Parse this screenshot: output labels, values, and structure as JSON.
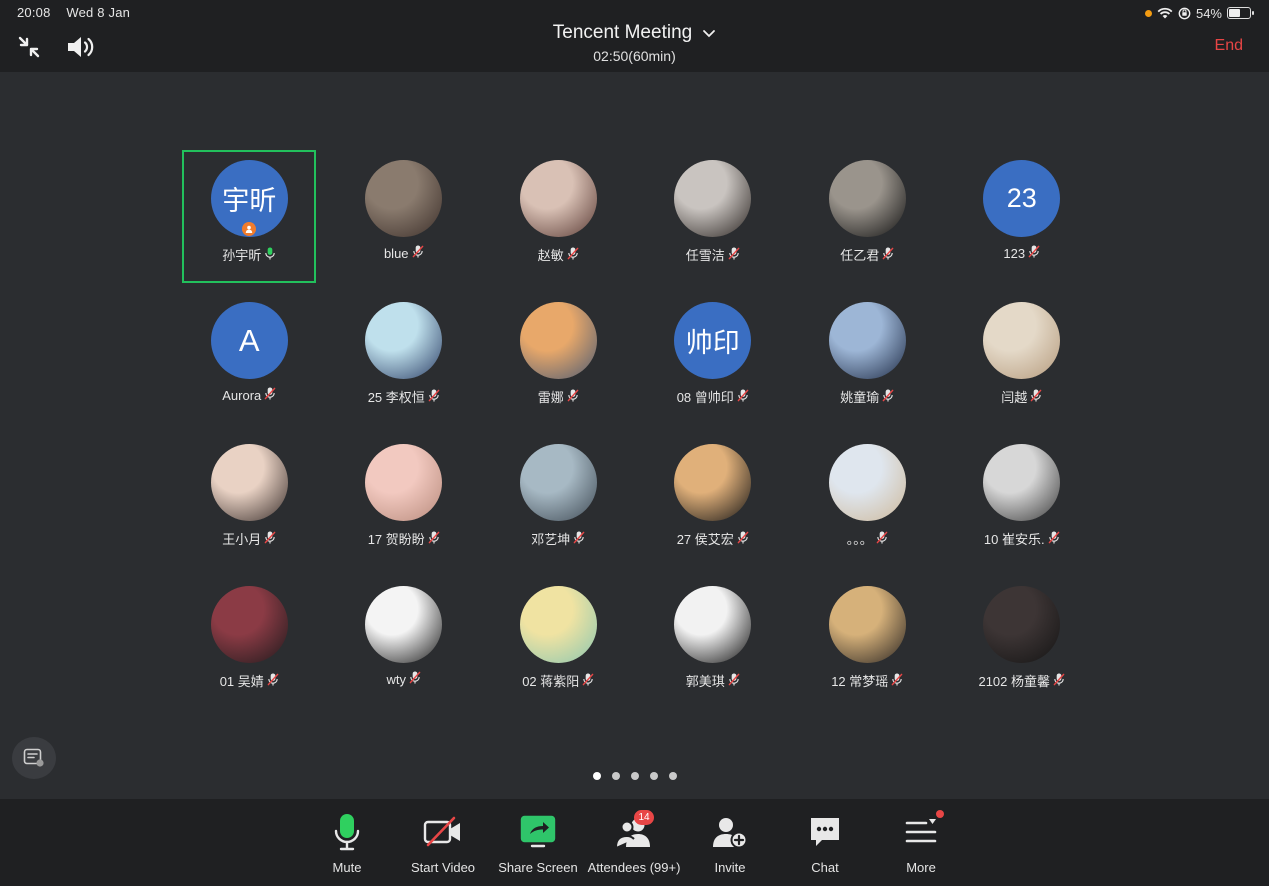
{
  "status_bar": {
    "time": "20:08",
    "date": "Wed 8 Jan",
    "battery": "54%",
    "battery_level": 0.54
  },
  "header": {
    "title": "Tencent Meeting",
    "timer": "02:50(60min)",
    "end_label": "End",
    "icons": [
      "collapse-icon",
      "speaker-icon",
      "chevron-down-icon"
    ]
  },
  "participants": [
    {
      "name": "孙宇昕",
      "avatar_text": "宇昕",
      "avatar_type": "text",
      "mic": "active",
      "host": true,
      "highlighted": true
    },
    {
      "name": "blue",
      "avatar_type": "photo",
      "mic": "muted",
      "photo_colors": [
        "#8a7b6e",
        "#3c2f2a"
      ]
    },
    {
      "name": "赵敏",
      "avatar_type": "photo",
      "mic": "muted",
      "photo_colors": [
        "#d9c1b5",
        "#5a3b35"
      ]
    },
    {
      "name": "任雪洁",
      "avatar_type": "photo",
      "mic": "muted",
      "photo_colors": [
        "#c9c4c0",
        "#2b2522"
      ]
    },
    {
      "name": "任乙君",
      "avatar_type": "photo",
      "mic": "muted",
      "photo_colors": [
        "#9a948c",
        "#111111"
      ]
    },
    {
      "name": "123",
      "avatar_text": "23",
      "avatar_type": "text",
      "mic": "muted"
    },
    {
      "name": "Aurora",
      "avatar_text": "A",
      "avatar_type": "text",
      "mic": "muted"
    },
    {
      "name": "25 李权恒",
      "avatar_type": "photo",
      "mic": "muted",
      "photo_colors": [
        "#bfe0ec",
        "#2d3f66"
      ]
    },
    {
      "name": "雷娜",
      "avatar_type": "photo",
      "mic": "muted",
      "photo_colors": [
        "#e8a86a",
        "#4d5b73"
      ]
    },
    {
      "name": "08 曾帅印",
      "avatar_text": "帅印",
      "avatar_type": "text",
      "mic": "muted"
    },
    {
      "name": "姚童瑜",
      "avatar_type": "photo",
      "mic": "muted",
      "photo_colors": [
        "#9db6d6",
        "#1e2b45"
      ]
    },
    {
      "name": "闫越",
      "avatar_type": "photo",
      "mic": "muted",
      "photo_colors": [
        "#e4d9c8",
        "#b59a7c"
      ]
    },
    {
      "name": "王小月",
      "avatar_type": "photo",
      "mic": "muted",
      "photo_colors": [
        "#e9d2c4",
        "#3a2f2c"
      ]
    },
    {
      "name": "17 贺盼盼",
      "avatar_type": "photo",
      "mic": "muted",
      "photo_colors": [
        "#f2c9c0",
        "#b78a7b"
      ]
    },
    {
      "name": "邓艺坤",
      "avatar_type": "photo",
      "mic": "muted",
      "photo_colors": [
        "#a7b9c4",
        "#3f4a54"
      ]
    },
    {
      "name": "27 侯艾宏",
      "avatar_type": "photo",
      "mic": "muted",
      "photo_colors": [
        "#e0b07a",
        "#151515"
      ]
    },
    {
      "name": "。。。",
      "avatar_type": "photo",
      "mic": "muted",
      "photo_colors": [
        "#dfe6ee",
        "#cdb89a"
      ]
    },
    {
      "name": "10 崔安乐.",
      "avatar_type": "photo",
      "mic": "muted",
      "photo_colors": [
        "#d7d7d7",
        "#3a3a3a"
      ]
    },
    {
      "name": "01 吴婧",
      "avatar_type": "photo",
      "mic": "muted",
      "photo_colors": [
        "#8b3b45",
        "#1e1a1c"
      ]
    },
    {
      "name": "wty",
      "avatar_type": "photo",
      "mic": "muted",
      "photo_colors": [
        "#f4f4f4",
        "#1a1a1a"
      ]
    },
    {
      "name": "02 蒋紫阳",
      "avatar_type": "photo",
      "mic": "muted",
      "photo_colors": [
        "#f0e3a2",
        "#8ac6b0"
      ]
    },
    {
      "name": "郭美琪",
      "avatar_type": "photo",
      "mic": "muted",
      "photo_colors": [
        "#f2f2f2",
        "#111111"
      ]
    },
    {
      "name": "12 常梦瑶",
      "avatar_type": "photo",
      "mic": "muted",
      "photo_colors": [
        "#d6b17a",
        "#2a2522"
      ]
    },
    {
      "name": "2102 杨童馨",
      "avatar_type": "photo",
      "mic": "muted",
      "photo_colors": [
        "#3d3535",
        "#141414"
      ]
    }
  ],
  "pager": {
    "pages": 5,
    "current": 0
  },
  "side_button": {
    "icon": "caption-icon"
  },
  "toolbar": [
    {
      "key": "mute",
      "label": "Mute",
      "icon": "microphone-icon"
    },
    {
      "key": "video",
      "label": "Start Video",
      "icon": "camera-off-icon"
    },
    {
      "key": "share",
      "label": "Share Screen",
      "icon": "share-screen-icon"
    },
    {
      "key": "attendees",
      "label": "Attendees (99+)",
      "icon": "attendees-icon",
      "badge": "14"
    },
    {
      "key": "invite",
      "label": "Invite",
      "icon": "invite-icon"
    },
    {
      "key": "chat",
      "label": "Chat",
      "icon": "chat-icon"
    },
    {
      "key": "more",
      "label": "More",
      "icon": "menu-icon",
      "dot": true
    }
  ],
  "colors": {
    "background": "#2b2d30",
    "bar": "#1f2022",
    "end": "#e64545",
    "mic_active": "#2fd05f",
    "highlight": "#22c05c",
    "text_avatar": "#3a6ec2"
  }
}
